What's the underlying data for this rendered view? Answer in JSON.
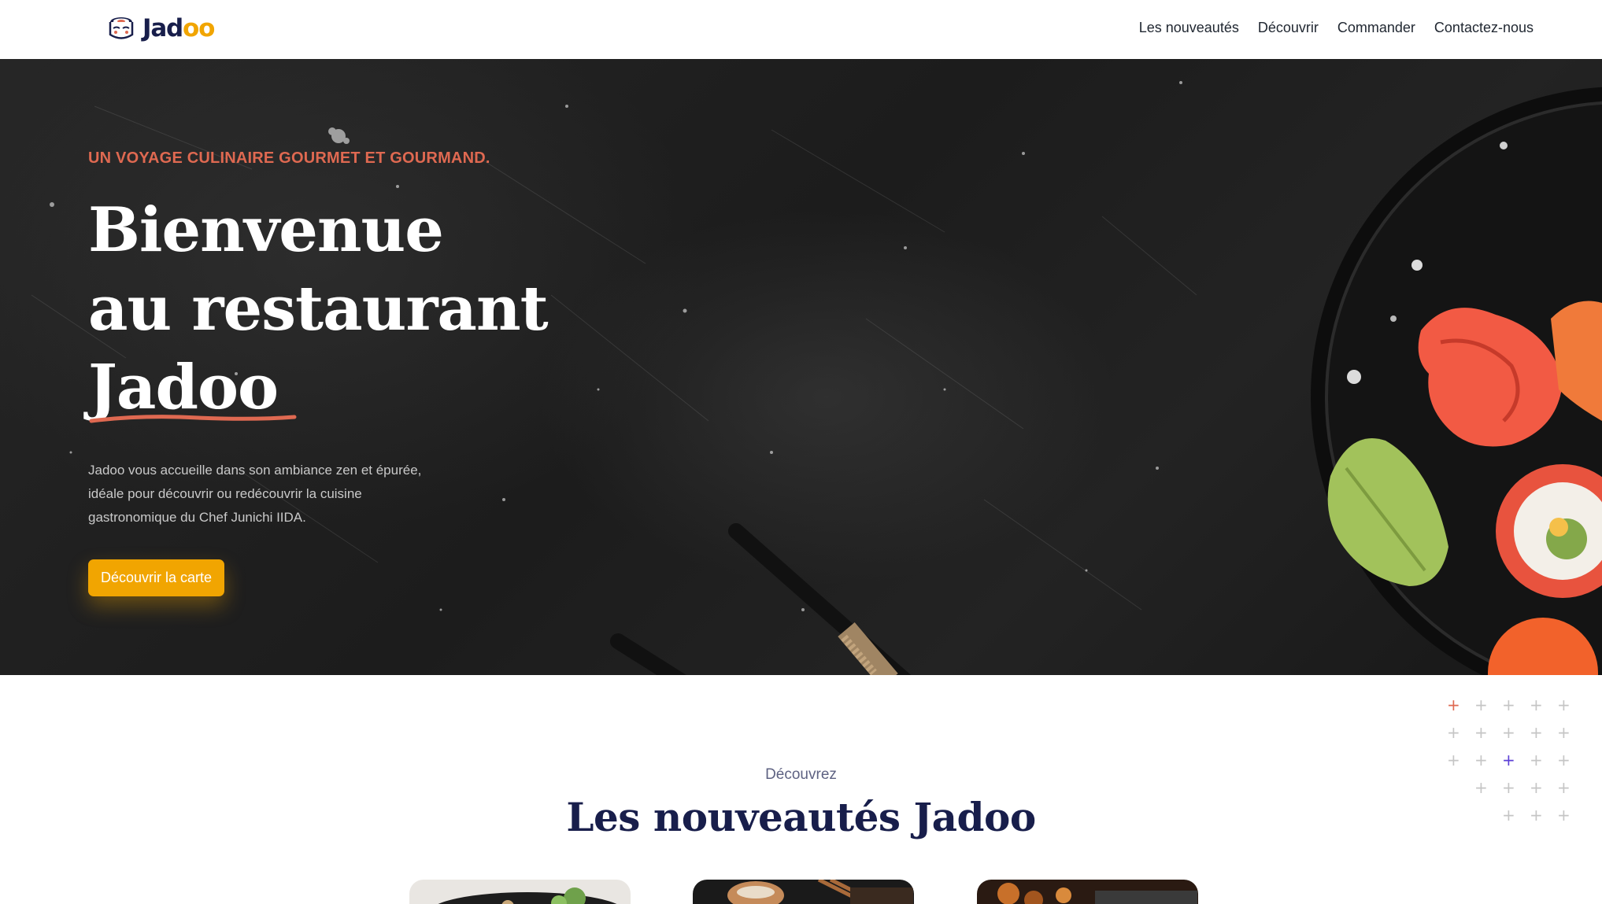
{
  "brand": {
    "name_prefix": "Jad",
    "name_suffix": "oo",
    "icon": "sushi-chef-logo-icon"
  },
  "nav": {
    "items": [
      {
        "label": "Les nouveautés"
      },
      {
        "label": "Découvrir"
      },
      {
        "label": "Commander"
      },
      {
        "label": "Contactez-nous"
      }
    ]
  },
  "hero": {
    "tagline": "UN VOYAGE CULINAIRE GOURMET ET GOURMAND.",
    "title_line1": "Bienvenue",
    "title_line2": "au restaurant",
    "title_line3": "Jadoo",
    "description": "Jadoo vous accueille dans son ambiance zen et épurée, idéale pour découvrir ou redécouvrir la cuisine gastronomique du Chef Junichi IIDA.",
    "cta_label": "Découvrir la carte"
  },
  "section": {
    "subtitle": "Découvrez",
    "title": "Les nouveautés Jadoo"
  },
  "colors": {
    "accent_orange": "#f1a501",
    "tagline_red": "#df6951",
    "navy": "#181e4b",
    "plus_red": "#df6951",
    "plus_purple": "#5b3fd6",
    "plus_grey": "#c5c5c5"
  }
}
